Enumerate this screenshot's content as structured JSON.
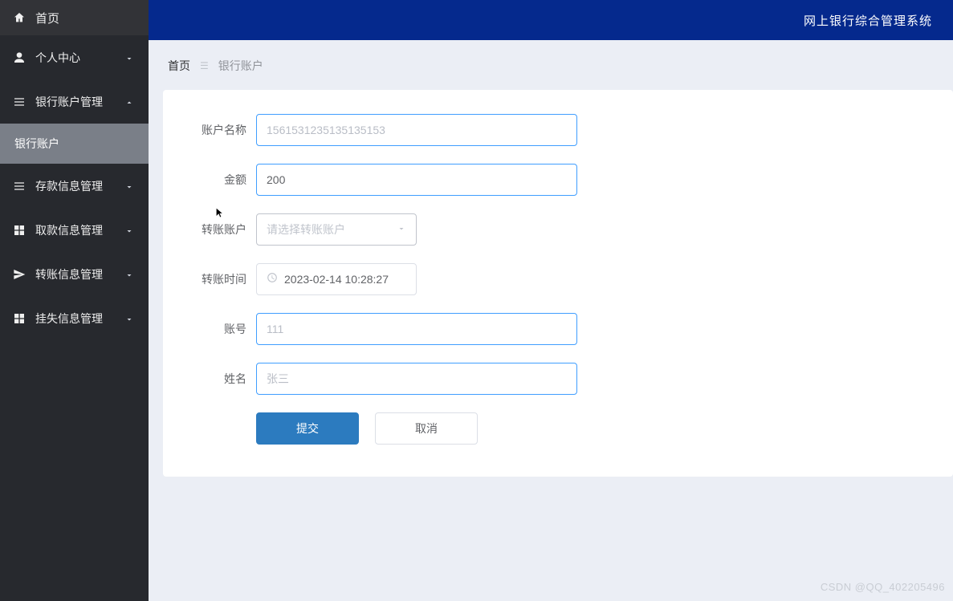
{
  "header": {
    "title": "网上银行综合管理系统"
  },
  "sidebar": {
    "home_label": "首页",
    "items": [
      {
        "label": "个人中心",
        "expanded": false
      },
      {
        "label": "银行账户管理",
        "expanded": true
      },
      {
        "label": "存款信息管理",
        "expanded": false
      },
      {
        "label": "取款信息管理",
        "expanded": false
      },
      {
        "label": "转账信息管理",
        "expanded": false
      },
      {
        "label": "挂失信息管理",
        "expanded": false
      }
    ],
    "sub_items": {
      "bank_account": "银行账户"
    }
  },
  "breadcrumb": {
    "home": "首页",
    "current": "银行账户"
  },
  "form": {
    "account_name": {
      "label": "账户名称",
      "value": "1561531235135135153"
    },
    "amount": {
      "label": "金额",
      "value": "200"
    },
    "transfer_account": {
      "label": "转账账户",
      "placeholder": "请选择转账账户"
    },
    "transfer_time": {
      "label": "转账时间",
      "value": "2023-02-14 10:28:27"
    },
    "account_no": {
      "label": "账号",
      "value": "111"
    },
    "name": {
      "label": "姓名",
      "value": "张三"
    },
    "submit": "提交",
    "cancel": "取消"
  },
  "watermark": "CSDN @QQ_402205496"
}
